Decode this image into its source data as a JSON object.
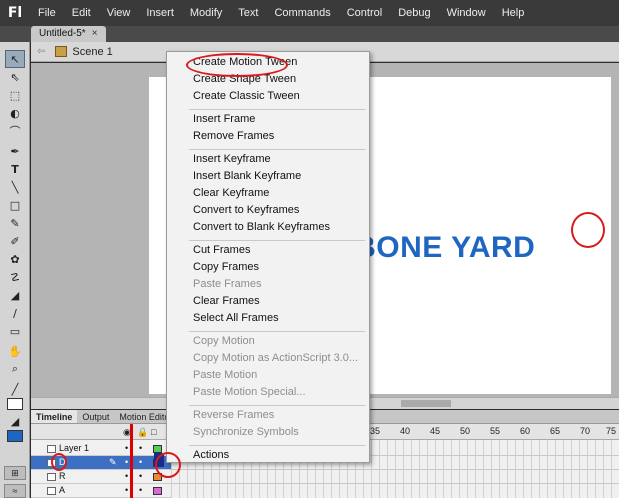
{
  "app": {
    "logo": "Fl"
  },
  "menubar": {
    "items": [
      "File",
      "Edit",
      "View",
      "Insert",
      "Modify",
      "Text",
      "Commands",
      "Control",
      "Debug",
      "Window",
      "Help"
    ]
  },
  "document_tab": {
    "title": "Untitled-5*",
    "close": "×"
  },
  "editbar": {
    "scene": "Scene 1"
  },
  "stage": {
    "text": "L BONE YARD",
    "text_color": "#1f66c2"
  },
  "timeline": {
    "tabs": [
      "Timeline",
      "Output",
      "Motion Editor"
    ],
    "frame_numbers": [
      "35",
      "40",
      "45",
      "50",
      "55",
      "60",
      "65",
      "70",
      "75"
    ],
    "layers": [
      {
        "name": "Layer 1",
        "color": "#55cc55"
      },
      {
        "name": "D",
        "color": "#4a4ad8"
      },
      {
        "name": "R",
        "color": "#ee8833"
      },
      {
        "name": "A",
        "color": "#dd66dd"
      }
    ]
  },
  "context_menu": {
    "groups": [
      [
        {
          "label": "Create Motion Tween",
          "enabled": true
        },
        {
          "label": "Create Shape Tween",
          "enabled": true
        },
        {
          "label": "Create Classic Tween",
          "enabled": true
        }
      ],
      [
        {
          "label": "Insert Frame",
          "enabled": true
        },
        {
          "label": "Remove Frames",
          "enabled": true
        }
      ],
      [
        {
          "label": "Insert Keyframe",
          "enabled": true
        },
        {
          "label": "Insert Blank Keyframe",
          "enabled": true
        },
        {
          "label": "Clear Keyframe",
          "enabled": true
        },
        {
          "label": "Convert to Keyframes",
          "enabled": true
        },
        {
          "label": "Convert to Blank Keyframes",
          "enabled": true
        }
      ],
      [
        {
          "label": "Cut Frames",
          "enabled": true
        },
        {
          "label": "Copy Frames",
          "enabled": true
        },
        {
          "label": "Paste Frames",
          "enabled": false
        },
        {
          "label": "Clear Frames",
          "enabled": true
        },
        {
          "label": "Select All Frames",
          "enabled": true
        }
      ],
      [
        {
          "label": "Copy Motion",
          "enabled": false
        },
        {
          "label": "Copy Motion as ActionScript 3.0...",
          "enabled": false
        },
        {
          "label": "Paste Motion",
          "enabled": false
        },
        {
          "label": "Paste Motion Special...",
          "enabled": false
        }
      ],
      [
        {
          "label": "Reverse Frames",
          "enabled": false
        },
        {
          "label": "Synchronize Symbols",
          "enabled": false
        }
      ],
      [
        {
          "label": "Actions",
          "enabled": true
        }
      ]
    ]
  },
  "colors": {
    "annotation": "#d81a1a",
    "menu_bg": "#f2f2f2",
    "stage_bg": "#ffffff"
  }
}
